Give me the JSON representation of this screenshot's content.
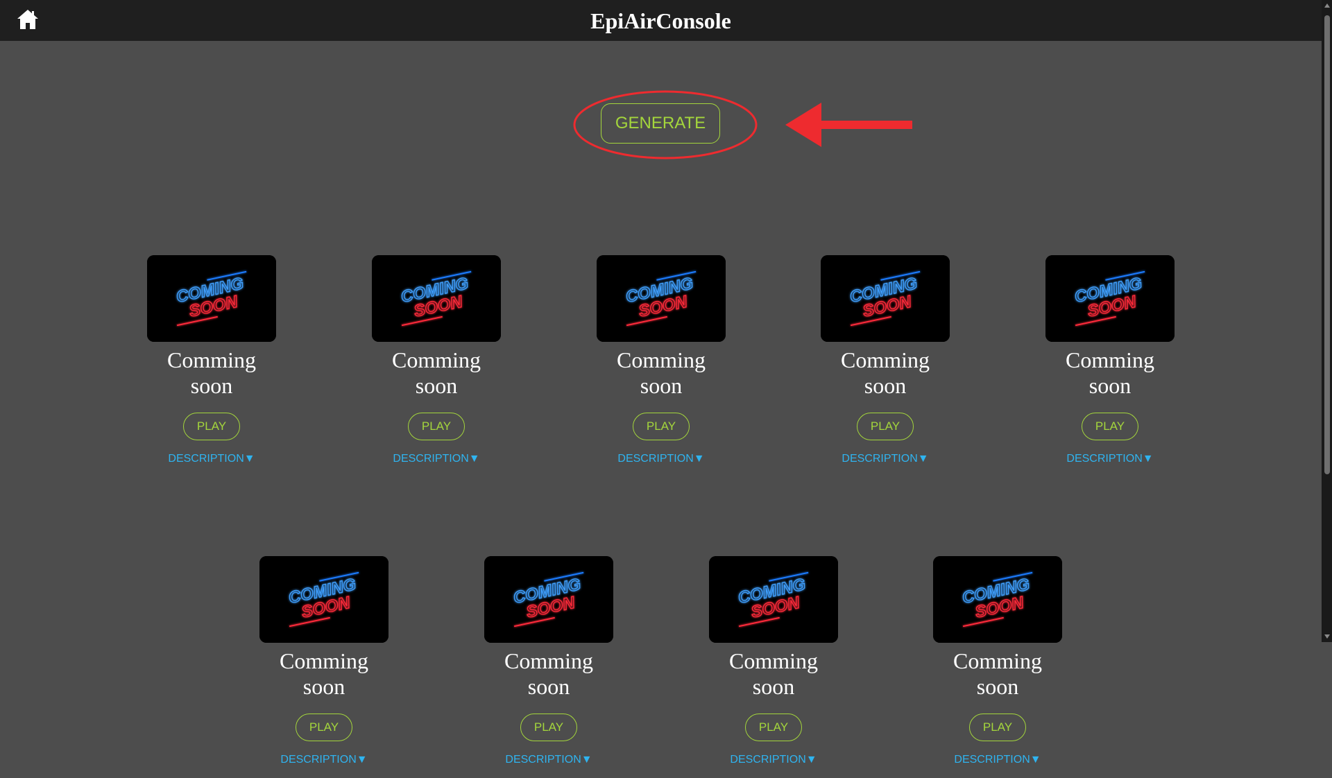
{
  "header": {
    "title": "EpiAirConsole",
    "home_icon": "home-icon"
  },
  "generate": {
    "label": "GENERATE"
  },
  "colors": {
    "accent_green": "#a4d63c",
    "link_blue": "#2fb4f0",
    "annotation_red": "#ee2b2f",
    "background": "#4d4d4d",
    "header_bg": "#1f1f1f"
  },
  "games": [
    {
      "title": "Comming soon",
      "play_label": "PLAY",
      "description_label": "DESCRIPTION▼",
      "thumbnail": "coming-soon-neon"
    },
    {
      "title": "Comming soon",
      "play_label": "PLAY",
      "description_label": "DESCRIPTION▼",
      "thumbnail": "coming-soon-neon"
    },
    {
      "title": "Comming soon",
      "play_label": "PLAY",
      "description_label": "DESCRIPTION▼",
      "thumbnail": "coming-soon-neon"
    },
    {
      "title": "Comming soon",
      "play_label": "PLAY",
      "description_label": "DESCRIPTION▼",
      "thumbnail": "coming-soon-neon"
    },
    {
      "title": "Comming soon",
      "play_label": "PLAY",
      "description_label": "DESCRIPTION▼",
      "thumbnail": "coming-soon-neon"
    },
    {
      "title": "Comming soon",
      "play_label": "PLAY",
      "description_label": "DESCRIPTION▼",
      "thumbnail": "coming-soon-neon"
    },
    {
      "title": "Comming soon",
      "play_label": "PLAY",
      "description_label": "DESCRIPTION▼",
      "thumbnail": "coming-soon-neon"
    },
    {
      "title": "Comming soon",
      "play_label": "PLAY",
      "description_label": "DESCRIPTION▼",
      "thumbnail": "coming-soon-neon"
    },
    {
      "title": "Comming soon",
      "play_label": "PLAY",
      "description_label": "DESCRIPTION▼",
      "thumbnail": "coming-soon-neon"
    }
  ],
  "thumbnail_text": {
    "line1": "COMING",
    "line2": "SOON"
  }
}
